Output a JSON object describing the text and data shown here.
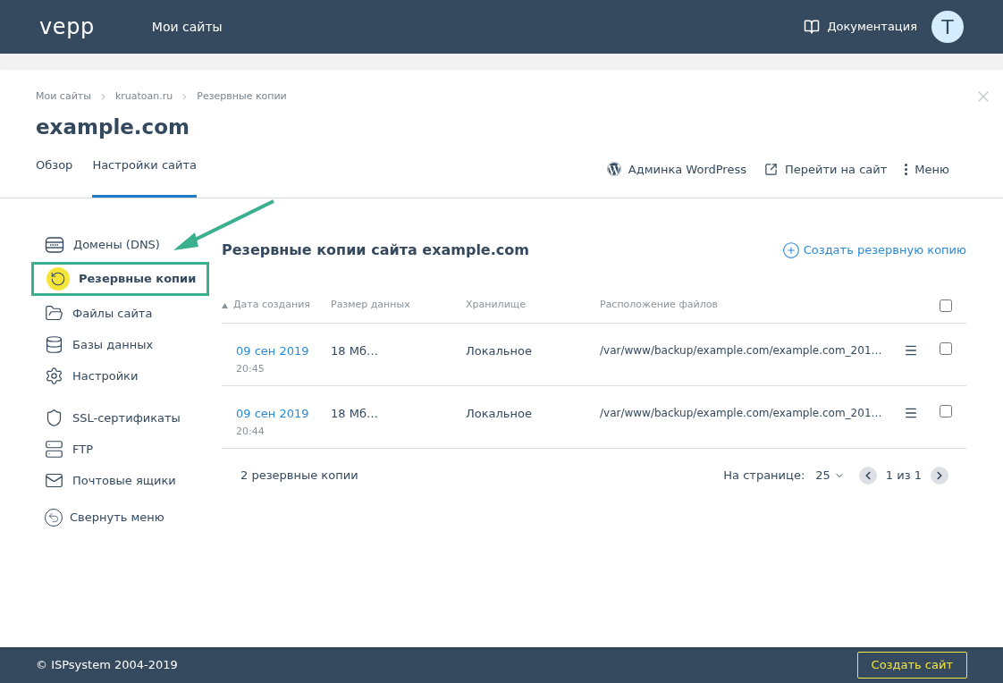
{
  "header": {
    "logo": "vepp",
    "nav": "Мои сайты",
    "docs": "Документация",
    "avatar": "T"
  },
  "breadcrumbs": [
    "Мои сайты",
    "kruatoan.ru",
    "Резервные копии"
  ],
  "title": "example.com",
  "tabs": [
    {
      "label": "Обзор",
      "selected": false
    },
    {
      "label": "Настройки сайта",
      "selected": true
    }
  ],
  "actions": [
    "Админка WordPress",
    "Перейти на сайт",
    "Меню"
  ],
  "sidebar": {
    "groups": [
      [
        {
          "label": "Домены (DNS)",
          "selected": false,
          "highlighted": false
        },
        {
          "label": "Резервные копии",
          "selected": true,
          "highlighted": true
        },
        {
          "label": "Файлы сайта",
          "selected": false,
          "highlighted": false
        },
        {
          "label": "Базы данных",
          "selected": false,
          "highlighted": false
        },
        {
          "label": "Настройки",
          "selected": false,
          "highlighted": false
        }
      ],
      [
        {
          "label": "SSL-сертификаты",
          "selected": false,
          "highlighted": false
        },
        {
          "label": "FTP",
          "selected": false,
          "highlighted": false
        },
        {
          "label": "Почтовые ящики",
          "selected": false,
          "highlighted": false
        }
      ]
    ],
    "collapse": "Свернуть меню"
  },
  "content": {
    "heading": "Резервные копии сайта example.com",
    "create": "Создать резервную копию",
    "table": {
      "columns": [
        "Дата создания",
        "Размер данных",
        "Хранилище",
        "Расположение файлов"
      ],
      "all_checked": false,
      "rows": [
        {
          "date": "09 сен 2019",
          "time": "20:45",
          "size": "18 Мб…",
          "storage": "Локальное",
          "path": "/var/www/backup/example.com/example.com_201…",
          "checked": false
        },
        {
          "date": "09 сен 2019",
          "time": "20:44",
          "size": "18 Мб…",
          "storage": "Локальное",
          "path": "/var/www/backup/example.com/example.com_201…",
          "checked": false
        }
      ]
    },
    "count": "2 резервные копии",
    "per_page_label": "На странице:",
    "per_page": "25",
    "page": "1 из 1"
  },
  "footer": {
    "copyright": "© ISPsystem 2004-2019",
    "button": "Создать сайт"
  }
}
